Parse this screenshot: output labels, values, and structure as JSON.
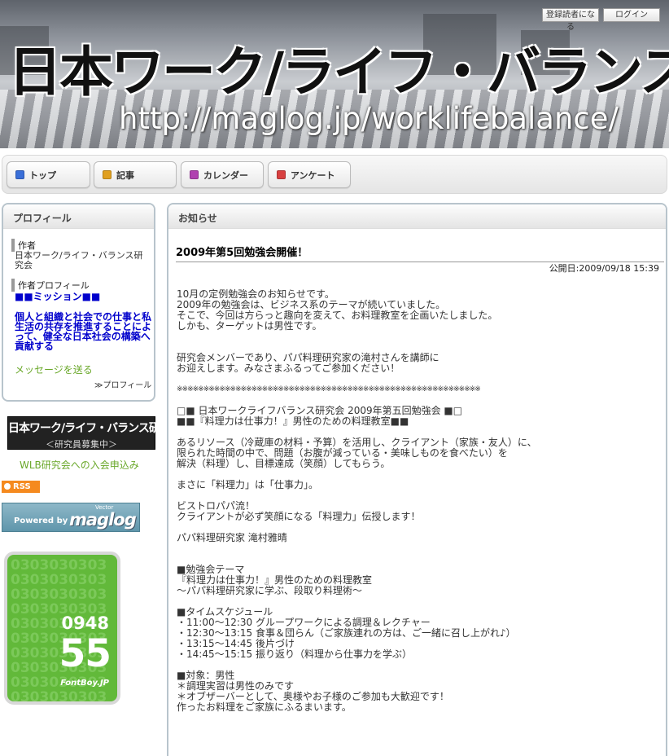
{
  "header": {
    "title": "日本ワーク/ライフ・バランス研究会",
    "url": "http://maglog.jp/worklifebalance/",
    "register_label": "登録読者になる",
    "login_label": "ログイン"
  },
  "nav": [
    {
      "label": "トップ",
      "icon": "home-icon",
      "color": "#3a6fd8"
    },
    {
      "label": "記事",
      "icon": "article-icon",
      "color": "#e0a020"
    },
    {
      "label": "カレンダー",
      "icon": "calendar-icon",
      "color": "#b040b0"
    },
    {
      "label": "アンケート",
      "icon": "survey-icon",
      "color": "#d84040"
    }
  ],
  "profile": {
    "heading": "プロフィール",
    "author_heading": "作者",
    "author_name": "日本ワーク/ライフ・バランス研究会",
    "author_profile_heading": "作者プロフィール",
    "mission": "■■ミッション■■",
    "mission_text": "個人と組織と社会での仕事と私生活の共存を推進することによって、健全な日本社会の構築へ貢献する",
    "message_link": "メッセージを送る",
    "profile_link": "≫プロフィール"
  },
  "banner": {
    "line1": "日本ワーク/ライフ・バランス研究会",
    "line2": "＜研究員募集中＞"
  },
  "join_link": "WLB研究会への入会申込み",
  "rss_label": "RSS",
  "maglog": {
    "powered_by": "Powered by",
    "logo": "maglog",
    "vector": "Vector"
  },
  "counter": {
    "background_digits": "0303030303030303030303030303030303030303030303030303030303030303030303030303030303030303030303030303030303030303",
    "top": "0948",
    "bottom": "55",
    "brand": "FontBoy.JP"
  },
  "main": {
    "heading": "お知らせ",
    "post_title": "2009年第5回勉強会開催！",
    "post_date": "公開日:2009/09/18 15:39",
    "body": [
      "10月の定例勉強会のお知らせです。",
      "2009年の勉強会は、ビジネス系のテーマが続いていました。",
      "そこで、今回は方らっと趣向を変えて、お料理教室を企画いたしました。",
      "しかも、ターゲットは男性です。",
      "",
      "",
      "研究会メンバーであり、パパ料理研究家の滝村さんを講師に",
      "お迎えします。みなさまふるってご参加ください！",
      "",
      "※※※※※※※※※※※※※※※※※※※※※※※※※※※※※※※※※※※※※※※※※※※※※※※※※※※※※※※※※",
      "",
      "□■ 日本ワークライフバランス研究会 2009年第五回勉強会 ■□",
      "■■『料理力は仕事力！』男性のための料理教室■■",
      "",
      "あるリソース（冷蔵庫の材料・予算）を活用し、クライアント（家族・友人）に、",
      "限られた時間の中で、問題（お腹が減っている・美味しものを食べたい）を",
      "解決（料理）し、目標達成（笑顔）してもらう。",
      "",
      "まさに「料理力」は「仕事力」。",
      "",
      "ビストロパパ流！",
      "クライアントが必ず笑顔になる「料理力」伝授します！",
      "",
      "パパ料理研究家 滝村雅晴",
      "",
      "",
      "■勉強会テーマ",
      "『料理力は仕事力！』男性のための料理教室",
      "～パパ料理研究家に学ぶ、段取り料理術～",
      "",
      "■タイムスケジュール",
      "・11:00～12:30 グループワークによる調理＆レクチャー",
      "・12:30～13:15 食事＆団らん（ご家族連れの方は、ご一緒に召し上がれ♪）",
      "・13:15～14:45 後片づけ",
      "・14:45～15:15 振り返り（料理から仕事力を学ぶ）",
      "",
      "■対象：男性",
      "＊調理実習は男性のみです",
      "＊オブザーバーとして、奥様やお子様のご参加も大歓迎です！",
      "作ったお料理をご家族にふるまいます。"
    ]
  }
}
